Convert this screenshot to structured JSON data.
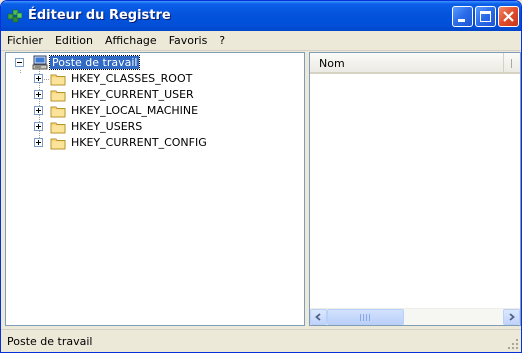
{
  "window": {
    "title": "Éditeur du Registre"
  },
  "menu": {
    "items": [
      "Fichier",
      "Edition",
      "Affichage",
      "Favoris",
      "?"
    ]
  },
  "tree": {
    "root": "Poste de travail",
    "children": [
      "HKEY_CLASSES_ROOT",
      "HKEY_CURRENT_USER",
      "HKEY_LOCAL_MACHINE",
      "HKEY_USERS",
      "HKEY_CURRENT_CONFIG"
    ]
  },
  "list": {
    "columns": [
      "Nom"
    ]
  },
  "status": {
    "text": "Poste de travail"
  },
  "colors": {
    "titlebar": "#0453dd",
    "selection": "#316ac5",
    "folder": "#f5d67a"
  },
  "icons": {
    "app": "registry-editor-icon",
    "root": "computer-icon",
    "key": "folder-icon"
  }
}
